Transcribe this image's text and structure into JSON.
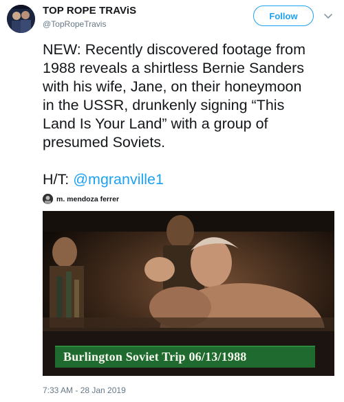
{
  "tweet": {
    "display_name": "TOP ROPE TRAViS",
    "handle": "@TopRopeTravis",
    "follow_label": "Follow",
    "text": "NEW: Recently discovered footage from\n1988 reveals a shirtless Bernie Sanders\nwith his wife, Jane, on their honeymoon\nin the USSR, drunkenly signing “This\nLand Is Your Land” with a group of\npresumed Soviets.",
    "ht_prefix": "H/T: ",
    "ht_mention": "@mgranville1",
    "timestamp": "7:33 AM - 28 Jan 2019"
  },
  "video": {
    "owner_name": "m. mendoza ferrer",
    "caption": "Burlington Soviet Trip 06/13/1988"
  },
  "colors": {
    "link": "#1da1f2",
    "secondary_text": "#657786",
    "caption_bg": "#1f6a2e"
  },
  "icons": {
    "more": "chevron-down-icon"
  }
}
